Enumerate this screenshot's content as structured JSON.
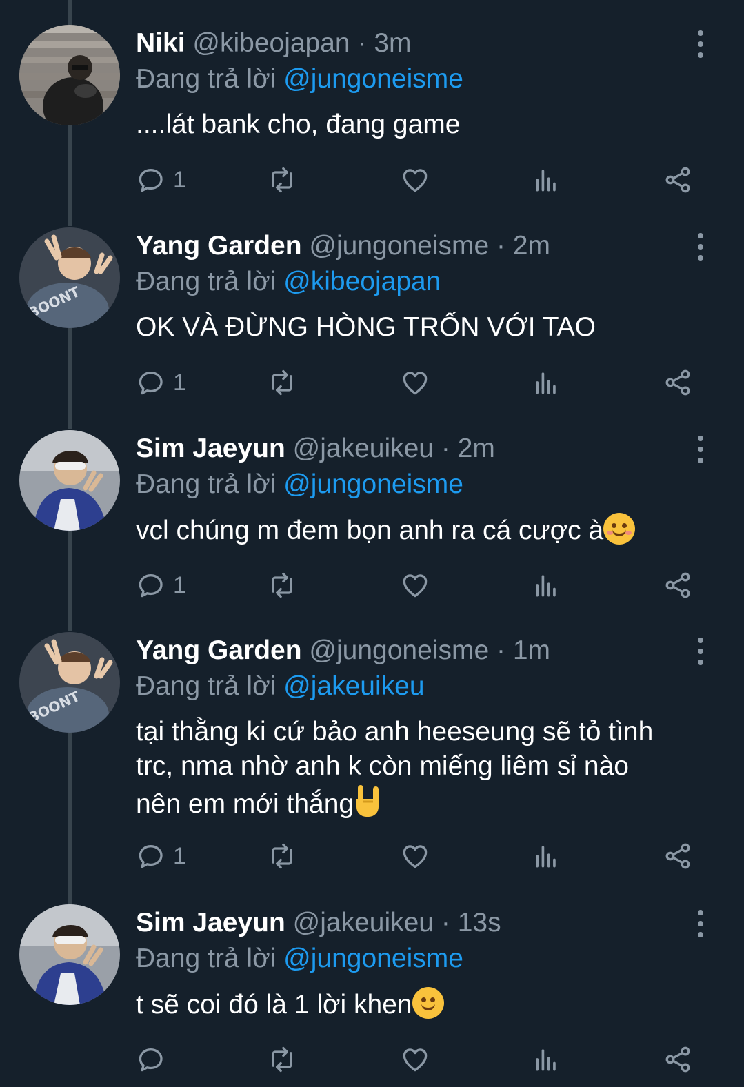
{
  "reply_prefix": "Đang trả lời",
  "tweets": [
    {
      "name": "Niki",
      "handle": "@kibeojapan",
      "time": "3m",
      "reply_to": "@jungoneisme",
      "text": "....lát bank cho, đang game",
      "reply_count": "1"
    },
    {
      "name": "Yang Garden",
      "handle": "@jungoneisme",
      "time": "2m",
      "reply_to": "@kibeojapan",
      "text": "OK VÀ ĐỪNG HÒNG TRỐN VỚI TAO",
      "reply_count": "1"
    },
    {
      "name": "Sim Jaeyun",
      "handle": "@jakeuikeu",
      "time": "2m",
      "reply_to": "@jungoneisme",
      "text": "vcl chúng m đem bọn anh ra cá cược à",
      "emoji": "smiling-blush-emoji",
      "reply_count": "1"
    },
    {
      "name": "Yang Garden",
      "handle": "@jungoneisme",
      "time": "1m",
      "reply_to": "@jakeuikeu",
      "text_lines": [
        "tại thằng ki cứ bảo anh heeseung sẽ tỏ tình",
        "trc, nma nhờ anh k còn miếng liêm sỉ nào",
        "nên em mới thắng"
      ],
      "emoji": "rock-on-hand-emoji",
      "reply_count": "1"
    },
    {
      "name": "Sim Jaeyun",
      "handle": "@jakeuikeu",
      "time": "13s",
      "reply_to": "@jungoneisme",
      "text": "t sẽ coi đó là 1 lời khen",
      "emoji": "slightly-smiling-emoji",
      "reply_count": ""
    }
  ],
  "colors": {
    "background": "#15202b",
    "secondary_text": "#8b98a5",
    "mention": "#1d9bf0",
    "thread_line": "#38444d"
  }
}
